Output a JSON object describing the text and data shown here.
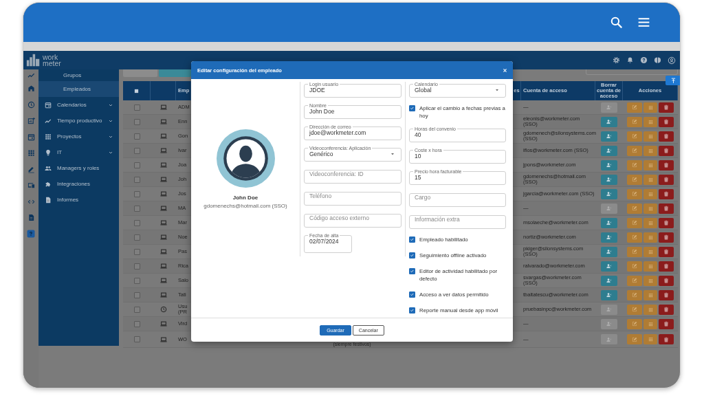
{
  "app_header": {
    "logo": "work meter"
  },
  "sidebar": {
    "items": [
      {
        "label": "Grupos",
        "kind": "subitem",
        "selected": false,
        "expandable": false
      },
      {
        "label": "Empleados",
        "kind": "subitem",
        "selected": true,
        "expandable": false
      },
      {
        "label": "Calendarios",
        "kind": "item",
        "selected": false,
        "expandable": true
      },
      {
        "label": "Tiempo productivo",
        "kind": "item",
        "selected": false,
        "expandable": true
      },
      {
        "label": "Proyectos",
        "kind": "item",
        "selected": false,
        "expandable": true
      },
      {
        "label": "IT",
        "kind": "item",
        "selected": false,
        "expandable": true
      },
      {
        "label": "Managers y roles",
        "kind": "item",
        "selected": false,
        "expandable": false
      },
      {
        "label": "Integraciones",
        "kind": "item",
        "selected": false,
        "expandable": false
      },
      {
        "label": "Informes",
        "kind": "item",
        "selected": false,
        "expandable": false
      }
    ]
  },
  "table": {
    "select_all": {
      "indeterminate": true
    },
    "columns": {
      "column_3": "Emp",
      "column_5": "es",
      "access_account": "Cuenta de acceso",
      "delete_access": "Borrar cuenta de acceso",
      "actions": "Acciones"
    },
    "rows": [
      {
        "checked": false,
        "kind": "laptop",
        "column_3": "ADM",
        "access_account": "—",
        "delete_enabled": false
      },
      {
        "checked": false,
        "kind": "laptop",
        "column_3": "Enn",
        "access_account": "eleonis@workmeter.com (SSO)",
        "delete_enabled": true
      },
      {
        "checked": false,
        "kind": "laptop",
        "column_3": "Gon",
        "access_account": "gdomenech@silonsystems.com (SSO)",
        "delete_enabled": true
      },
      {
        "checked": false,
        "kind": "laptop",
        "column_3": "Ivar",
        "access_account": "iflos@workmeter.com (SSO)",
        "delete_enabled": true
      },
      {
        "checked": false,
        "kind": "laptop",
        "column_3": "Joa",
        "access_account": "jpons@workmeter.com",
        "delete_enabled": true
      },
      {
        "checked": false,
        "kind": "laptop",
        "column_3": "Joh",
        "access_account": "gdomenechs@hotmail.com (SSO)",
        "delete_enabled": true
      },
      {
        "checked": false,
        "kind": "laptop",
        "column_3": "Jos",
        "access_account": "jgarcia@workmeter.com (SSO)",
        "delete_enabled": true
      },
      {
        "checked": false,
        "kind": "laptop",
        "column_3": "MA",
        "access_account": "—",
        "delete_enabled": false
      },
      {
        "checked": false,
        "kind": "laptop",
        "column_3": "Mar",
        "access_account": "msolaeche@workmeter.com",
        "delete_enabled": true
      },
      {
        "checked": false,
        "kind": "laptop",
        "column_3": "Noe",
        "access_account": "nortiz@workmeter.com",
        "delete_enabled": true
      },
      {
        "checked": false,
        "kind": "laptop",
        "column_3": "Pas",
        "access_account": "pkiger@silonsystems.com (SSO)",
        "delete_enabled": true
      },
      {
        "checked": false,
        "kind": "laptop",
        "column_3": "Rica",
        "access_account": "ralvarado@workmeter.com",
        "delete_enabled": true
      },
      {
        "checked": false,
        "kind": "laptop",
        "column_3": "Salo",
        "access_account": "svargas@workmeter.com (SSO)",
        "delete_enabled": true
      },
      {
        "checked": false,
        "kind": "laptop",
        "column_3": "Tati",
        "access_account": "tbaltatescu@workmeter.com",
        "delete_enabled": true
      },
      {
        "checked": false,
        "kind": "clock",
        "column_3": "Usu (PR",
        "access_account": "pruebasinpc@workmeter.com",
        "delete_enabled": false
      },
      {
        "checked": false,
        "kind": "laptop",
        "column_3": "Vird",
        "access_account": "—",
        "delete_enabled": false
      },
      {
        "checked": false,
        "kind": "laptop",
        "column_3": "WO",
        "column_4": "(siempre festivos)",
        "access_account": "—",
        "delete_enabled": false
      }
    ]
  },
  "modal": {
    "title": "Editar configuración del empleado",
    "profile": {
      "name": "John Doe",
      "email": "gdomenechs@hotmail.com (SSO)"
    },
    "fields_left": [
      {
        "kind": "text",
        "label": "Login usuario",
        "value": "JDOE"
      },
      {
        "kind": "text",
        "label": "Nombre",
        "value": "John Doe"
      },
      {
        "kind": "text",
        "label": "Dirección de correo",
        "value": "jdoe@workmeter.com"
      },
      {
        "kind": "select",
        "label": "Videoconferencia: Aplicación",
        "value": "Genérico"
      },
      {
        "kind": "text",
        "placeholder": "Videoconferencia: ID"
      },
      {
        "kind": "text",
        "placeholder": "Teléfono"
      },
      {
        "kind": "text",
        "placeholder": "Código acceso externo"
      },
      {
        "kind": "date",
        "label": "Fecha de alta",
        "value": "02/07/2024"
      }
    ],
    "fields_right": [
      {
        "kind": "select",
        "label": "Calendario",
        "value": "Global"
      },
      {
        "kind": "checkbox",
        "label": "Aplicar el cambio a fechas previas a hoy",
        "checked": true
      },
      {
        "kind": "text",
        "label": "Horas del convenio",
        "value": "40"
      },
      {
        "kind": "text",
        "label": "Coste x hora",
        "value": "10"
      },
      {
        "kind": "text",
        "label": "Precio hora facturable",
        "value": "15"
      },
      {
        "kind": "text",
        "placeholder": "Cargo"
      },
      {
        "kind": "text",
        "placeholder": "Información extra"
      },
      {
        "kind": "checkbox",
        "label": "Empleado habilitado",
        "checked": true
      },
      {
        "kind": "checkbox",
        "label": "Seguimiento offline activado",
        "checked": true
      },
      {
        "kind": "checkbox",
        "label": "Editor de actividad habilitado por defecto",
        "checked": true
      },
      {
        "kind": "checkbox",
        "label": "Acceso a ver datos permitido",
        "checked": true
      },
      {
        "kind": "checkbox",
        "label": "Reporte manual desde app móvil",
        "checked": true
      }
    ],
    "buttons": [
      {
        "label": "Guardar",
        "kind": "primary"
      },
      {
        "label": "Cancelar",
        "kind": "secondary"
      }
    ]
  }
}
